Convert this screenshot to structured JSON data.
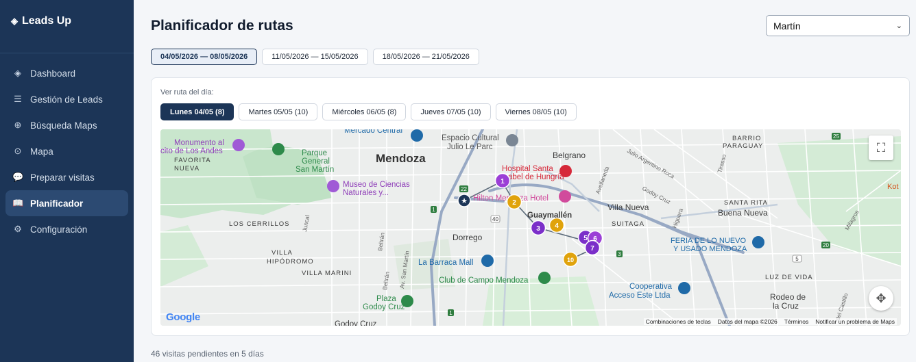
{
  "app": {
    "brand": "Leads Up",
    "brand_icon": "diamond-icon"
  },
  "sidebar": {
    "items": [
      {
        "label": "Dashboard",
        "icon": "diamond-icon",
        "glyph": "◈"
      },
      {
        "label": "Gestión de Leads",
        "icon": "list-icon",
        "glyph": "☰"
      },
      {
        "label": "Búsqueda Maps",
        "icon": "crosshair-icon",
        "glyph": "⊕"
      },
      {
        "label": "Mapa",
        "icon": "target-icon",
        "glyph": "⊙"
      },
      {
        "label": "Preparar visitas",
        "icon": "chat-icon",
        "glyph": "💬"
      },
      {
        "label": "Planificador",
        "icon": "book-icon",
        "glyph": "📖"
      },
      {
        "label": "Configuración",
        "icon": "gear-icon",
        "glyph": "⚙"
      }
    ],
    "active_index": 5
  },
  "page": {
    "title": "Planificador de rutas"
  },
  "user_select": {
    "value": "Martín"
  },
  "weeks": [
    {
      "label": "04/05/2026 — 08/05/2026",
      "active": true
    },
    {
      "label": "11/05/2026 — 15/05/2026",
      "active": false
    },
    {
      "label": "18/05/2026 — 21/05/2026",
      "active": false
    }
  ],
  "day_selector": {
    "label": "Ver ruta del día:",
    "days": [
      {
        "label": "Lunes 04/05 (8)",
        "active": true
      },
      {
        "label": "Martes 05/05 (10)",
        "active": false
      },
      {
        "label": "Miércoles 06/05 (8)",
        "active": false
      },
      {
        "label": "Jueves 07/05 (10)",
        "active": false
      },
      {
        "label": "Viernes 08/05 (10)",
        "active": false
      }
    ]
  },
  "map": {
    "place_labels": {
      "mendoza": "Mendoza",
      "belgrano": "Belgrano",
      "villa_nueva": "Villa Nueva",
      "suitaga": "SUITAGA",
      "guaymallen": "Guaymallén",
      "dorrego": "Dorrego",
      "los_cerrillos": "LOS CERRILLOS",
      "villa_hipodromo_1": "VILLA",
      "villa_hipodromo_2": "HIPÓDROMO",
      "villa_marini": "VILLA MARINI",
      "barrio_paraguay_1": "BARRIO",
      "barrio_paraguay_2": "PARAGUAY",
      "santa_rita": "SANTA RITA",
      "buena_nueva": "Buena Nueva",
      "luz_de_vida": "LUZ DE VIDA",
      "rodeo_1": "Rodeo de",
      "rodeo_2": "la Cruz",
      "godoy_cruz": "Godoy Cruz",
      "favorita_1": "FAVORITA",
      "favorita_2": "NUEVA",
      "kot": "Kot"
    },
    "poi": {
      "mercado": "Mercado Central",
      "espacio_1": "Espacio Cultural",
      "espacio_2": "Julio Le Parc",
      "monumento_1": "Monumento al",
      "monumento_2": "cito de Los Andes",
      "parque_1": "Parque",
      "parque_2": "General",
      "parque_3": "San Martín",
      "museo_1": "Museo de Ciencias",
      "museo_2": "Naturales y...",
      "hospital_1": "Hospital Santa",
      "hospital_2": "Isabel de Hungría",
      "hilton": "Hilton Mendoza Hotel",
      "barraca": "La Barraca Mall",
      "club": "Club de Campo Mendoza",
      "plaza_1": "Plaza",
      "plaza_2": "Godoy Cruz",
      "feria_1": "FERIA DE LO NUEVO",
      "feria_2": "Y USADO MENDOZA",
      "coop_1": "Cooperativa",
      "coop_2": "Acceso Este Ltda"
    },
    "streets": {
      "avellaneda": "Avellaneda",
      "julio_roca": "Julio Argentino Roca",
      "godoy_cruz": "Godoy Cruz",
      "higuera": "Higuera",
      "tirasso": "Tirasso",
      "milagros": "Milagros",
      "juncal": "Juncal",
      "beltran": "Beltrán",
      "san_martin": "Av. San Martín",
      "beltran_2": "Beltrán",
      "del_castillo": "del Castillo"
    },
    "route_badges": [
      "22",
      "40",
      "1",
      "25",
      "20",
      "3",
      "5",
      "1"
    ],
    "stops": [
      {
        "n": "1",
        "color": "#9b3fd6"
      },
      {
        "n": "2",
        "color": "#e0a30c"
      },
      {
        "n": "3",
        "color": "#7b2fc9"
      },
      {
        "n": "4",
        "color": "#e0a30c"
      },
      {
        "n": "5",
        "color": "#7b2fc9"
      },
      {
        "n": "6",
        "color": "#9b3fd6"
      },
      {
        "n": "7",
        "color": "#7b2fc9"
      },
      {
        "n": "10",
        "color": "#e0a30c"
      }
    ],
    "start_icon": "star-icon",
    "google_logo": "Google",
    "attribution": {
      "shortcuts": "Combinaciones de teclas",
      "data": "Datos del mapa ©2026",
      "terms": "Términos",
      "report": "Notificar un problema de Maps"
    }
  },
  "footer": {
    "text": "46 visitas pendientes en 5 días"
  }
}
